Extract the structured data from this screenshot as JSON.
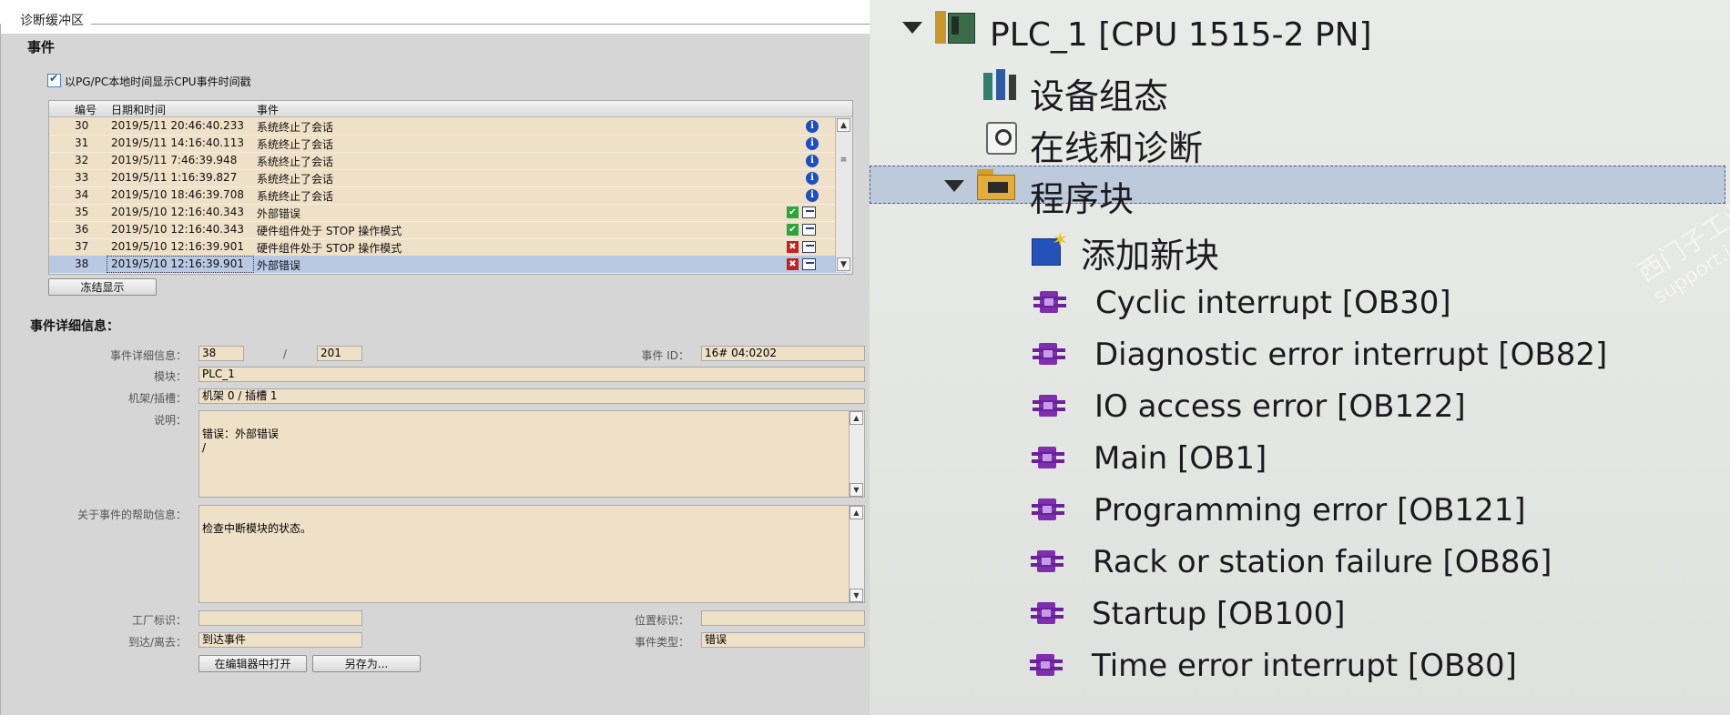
{
  "diagnostic_panel": {
    "title": "诊断缓冲区",
    "events_section_title": "事件",
    "local_time_checkbox": {
      "label": "以PG/PC本地时间显示CPU事件时间戳",
      "checked": true
    },
    "table": {
      "headers": [
        "编号",
        "日期和时间",
        "事件"
      ],
      "rows": [
        {
          "no": "30",
          "datetime": "2019/5/11 20:46:40.233",
          "event": "系统终止了会话",
          "status": "info"
        },
        {
          "no": "31",
          "datetime": "2019/5/11 14:16:40.113",
          "event": "系统终止了会话",
          "status": "info"
        },
        {
          "no": "32",
          "datetime": "2019/5/11 7:46:39.948",
          "event": "系统终止了会话",
          "status": "info"
        },
        {
          "no": "33",
          "datetime": "2019/5/11 1:16:39.827",
          "event": "系统终止了会话",
          "status": "info"
        },
        {
          "no": "34",
          "datetime": "2019/5/10 18:46:39.708",
          "event": "系统终止了会话",
          "status": "info"
        },
        {
          "no": "35",
          "datetime": "2019/5/10 12:16:40.343",
          "event": "外部错误",
          "status": "outgoing-ok"
        },
        {
          "no": "36",
          "datetime": "2019/5/10 12:16:40.343",
          "event": "硬件组件处于 STOP 操作模式",
          "status": "outgoing-ok"
        },
        {
          "no": "37",
          "datetime": "2019/5/10 12:16:39.901",
          "event": "硬件组件处于 STOP 操作模式",
          "status": "incoming-error"
        },
        {
          "no": "38",
          "datetime": "2019/5/10 12:16:39.901",
          "event": "外部错误",
          "status": "incoming-error"
        }
      ],
      "selected_row": "38"
    },
    "freeze_button_label": "冻结显示",
    "details": {
      "title": "事件详细信息：",
      "detail_label": "事件详细信息：",
      "detail_index": "38",
      "separator": "/",
      "detail_total": "201",
      "event_id_label": "事件 ID：",
      "event_id_value": "16# 04:0202",
      "module_label": "模块：",
      "module_value": "PLC_1",
      "rack_slot_label": "机架/插槽：",
      "rack_slot_value": "机架 0 / 插槽 1",
      "description_label": "说明：",
      "description_value": "错误：外部错误\n/",
      "help_label": "关于事件的帮助信息：",
      "help_value": "检查中断模块的状态。",
      "plant_id_label": "工厂标识：",
      "plant_id_value": "",
      "location_id_label": "位置标识：",
      "location_id_value": "",
      "direction_label": "到达/离去：",
      "direction_value": "到达事件",
      "event_type_label": "事件类型：",
      "event_type_value": "错误",
      "open_in_editor_label": "在编辑器中打开",
      "save_as_label": "另存为..."
    }
  },
  "project_tree": {
    "root": "PLC_1 [CPU 1515-2 PN]",
    "device_config": "设备组态",
    "online_diag": "在线和诊断",
    "program_blocks": "程序块",
    "add_new_block": "添加新块",
    "blocks": [
      "Cyclic interrupt [OB30]",
      "Diagnostic error interrupt [OB82]",
      "IO access error [OB122]",
      "Main [OB1]",
      "Programming error [OB121]",
      "Rack or station failure [OB86]",
      "Startup [OB100]",
      "Time error interrupt [OB80]"
    ],
    "watermark_cn": "西门子工业 找答案",
    "watermark_url": "support.industry.siemens.com/cs"
  }
}
